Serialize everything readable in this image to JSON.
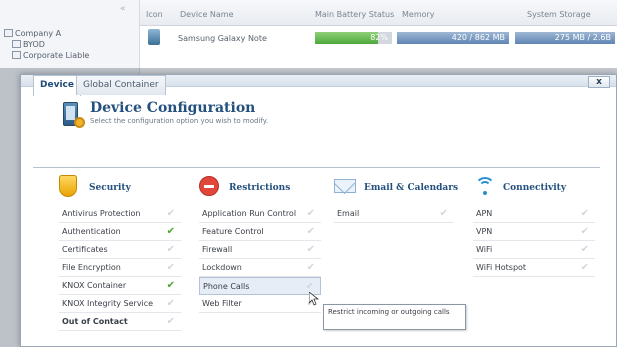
{
  "background": {
    "tree": [
      "Company A",
      "BYOD",
      "Corporate Liable"
    ],
    "columns": [
      "Icon",
      "Device Name",
      "Main Battery Status",
      "Memory",
      "System Storage"
    ],
    "device": {
      "name": "Samsung Galaxy Note",
      "battery": "82%",
      "battery_level": 0.82,
      "memory": "420 / 862 MB",
      "storage": "275 MB / 2.6B"
    }
  },
  "dialog": {
    "title": "Device Configuration",
    "subtitle": "Select the configuration option you wish to modify.",
    "close_label": "x",
    "tabs": [
      "Device",
      "Global Container"
    ],
    "columns": [
      {
        "icon": "shield-icon",
        "title": "Security",
        "items": [
          {
            "label": "Antivirus Protection",
            "checked": false
          },
          {
            "label": "Authentication",
            "checked": true
          },
          {
            "label": "Certificates",
            "checked": false
          },
          {
            "label": "File Encryption",
            "checked": false
          },
          {
            "label": "KNOX Container",
            "checked": true
          },
          {
            "label": "KNOX Integrity Service",
            "checked": false
          },
          {
            "label": "Out of Contact",
            "checked": false
          }
        ]
      },
      {
        "icon": "no-entry-icon",
        "title": "Restrictions",
        "items": [
          {
            "label": "Application Run Control",
            "checked": false
          },
          {
            "label": "Feature Control",
            "checked": false
          },
          {
            "label": "Firewall",
            "checked": false
          },
          {
            "label": "Lockdown",
            "checked": false
          },
          {
            "label": "Phone Calls",
            "checked": false
          },
          {
            "label": "Web Filter",
            "checked": false
          }
        ]
      },
      {
        "icon": "envelope-icon",
        "title": "Email & Calendars",
        "items": [
          {
            "label": "Email",
            "checked": false
          }
        ]
      },
      {
        "icon": "wifi-icon",
        "title": "Connectivity",
        "items": [
          {
            "label": "APN",
            "checked": false
          },
          {
            "label": "VPN",
            "checked": false
          },
          {
            "label": "WiFi",
            "checked": false
          },
          {
            "label": "WiFi Hotspot",
            "checked": false
          }
        ]
      }
    ],
    "tooltip": "Restrict incoming or outgoing calls",
    "check_glyph": "✔"
  }
}
